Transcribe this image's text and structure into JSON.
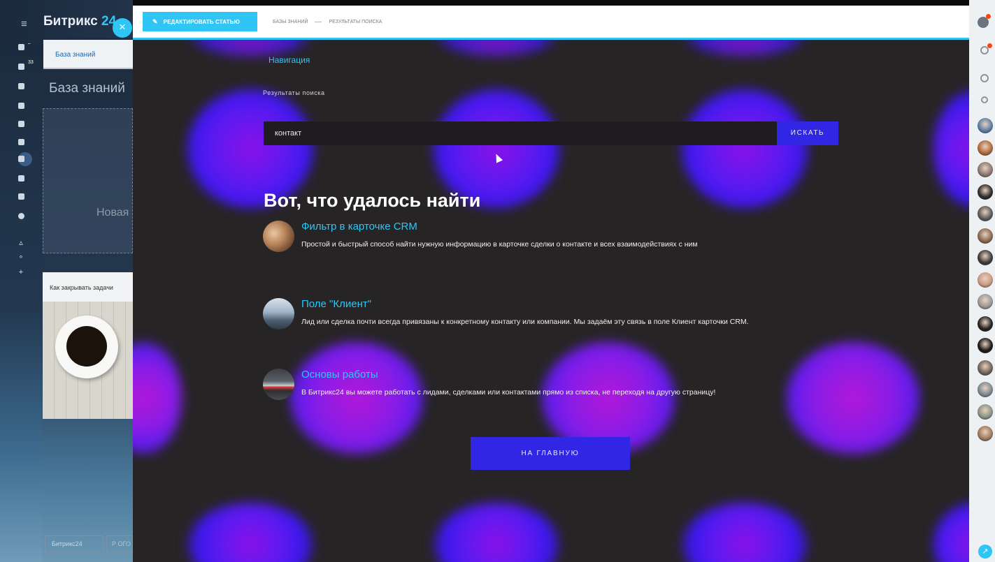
{
  "app": {
    "brand_name": "Битрикс",
    "brand_num": "24",
    "close_label": "×"
  },
  "left_panel": {
    "tab_label": "База знаний",
    "page_title": "База знаний",
    "new_label": "Новая",
    "card_title": "Как закрывать задачи",
    "footer_label": "Битрикс24",
    "footer_label2": "Р ОГО",
    "menu_icons": [
      "tasks-icon",
      "feed-icon",
      "chat-icon",
      "calendar-icon",
      "drive-icon",
      "mail-icon",
      "knowledge-base-icon",
      "crm-icon",
      "groups-icon",
      "marketplace-icon",
      "sites-icon",
      "settings-icon",
      "add-icon"
    ],
    "badges": [
      "2",
      "33"
    ]
  },
  "slider": {
    "edit_button": "РЕДАКТИРОВАТЬ СТАТЬЮ",
    "crumbs": [
      "БАЗЫ ЗНАНИЙ",
      "РЕЗУЛЬТАТЫ ПОИСКА"
    ],
    "nav_link": "Навигация",
    "subtitle": "Результаты поиска",
    "search_value": "контакт",
    "search_button": "ИСКАТЬ",
    "headline": "Вот, что удалось найти",
    "results": [
      {
        "title": "Фильтр в карточке CRM",
        "description": "Простой и быстрый способ найти нужную информацию в карточке сделки о контакте и всех взаимодействиях с ним"
      },
      {
        "title": "Поле \"Клиент\"",
        "description": "Лид или сделка почти всегда привязаны к конкретному контакту или компании. Мы задаём эту связь в поле Клиент карточки CRM."
      },
      {
        "title": "Основы работы",
        "description": "В Битрикс24 вы можете работать с лидами, сделками или контактами прямо из списка, не переходя на другую страницу!"
      }
    ],
    "home_button": "НА ГЛАВНУЮ"
  },
  "right_panel": {
    "icons": [
      "help-icon",
      "notifications-icon",
      "timeman-icon",
      "search-icon"
    ],
    "avatar_count": 15,
    "bottom_icon": "open-lines-icon"
  },
  "colors": {
    "accent": "#2fc6f6",
    "button": "#3026e4",
    "background": "#272426"
  }
}
